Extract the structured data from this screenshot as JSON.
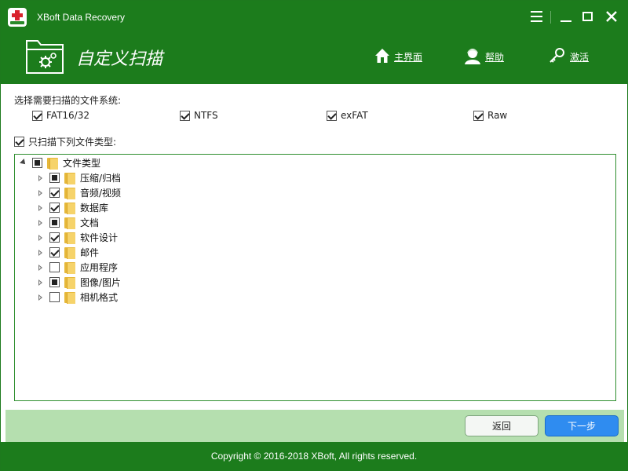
{
  "window": {
    "title": "XBoft Data Recovery"
  },
  "header": {
    "page_title": "自定义扫描",
    "nav": {
      "home_label": "主界面",
      "help_label": "帮助",
      "activate_label": "激活"
    }
  },
  "filesystems": {
    "label": "选择需要扫描的文件系统:",
    "options": [
      {
        "label": "FAT16/32",
        "checked": true
      },
      {
        "label": "NTFS",
        "checked": true
      },
      {
        "label": "exFAT",
        "checked": true
      },
      {
        "label": "Raw",
        "checked": true
      }
    ]
  },
  "file_types": {
    "only_label": "只扫描下列文件类型:",
    "only_checked": true,
    "root": {
      "label": "文件类型",
      "state": "partial"
    },
    "items": [
      {
        "label": "压缩/归档",
        "state": "partial"
      },
      {
        "label": "音频/视频",
        "state": "checked"
      },
      {
        "label": "数据库",
        "state": "checked"
      },
      {
        "label": "文档",
        "state": "partial"
      },
      {
        "label": "软件设计",
        "state": "checked"
      },
      {
        "label": "邮件",
        "state": "checked"
      },
      {
        "label": "应用程序",
        "state": "unchecked"
      },
      {
        "label": "图像/图片",
        "state": "partial"
      },
      {
        "label": "相机格式",
        "state": "unchecked"
      }
    ]
  },
  "actions": {
    "back_label": "返回",
    "next_label": "下一步"
  },
  "footer": {
    "copyright": "Copyright © 2016-2018 XBoft, All rights reserved."
  },
  "colors": {
    "brand_green": "#1c7c1c",
    "action_bar": "#b5dfaf",
    "next_button": "#2f8cf0"
  }
}
